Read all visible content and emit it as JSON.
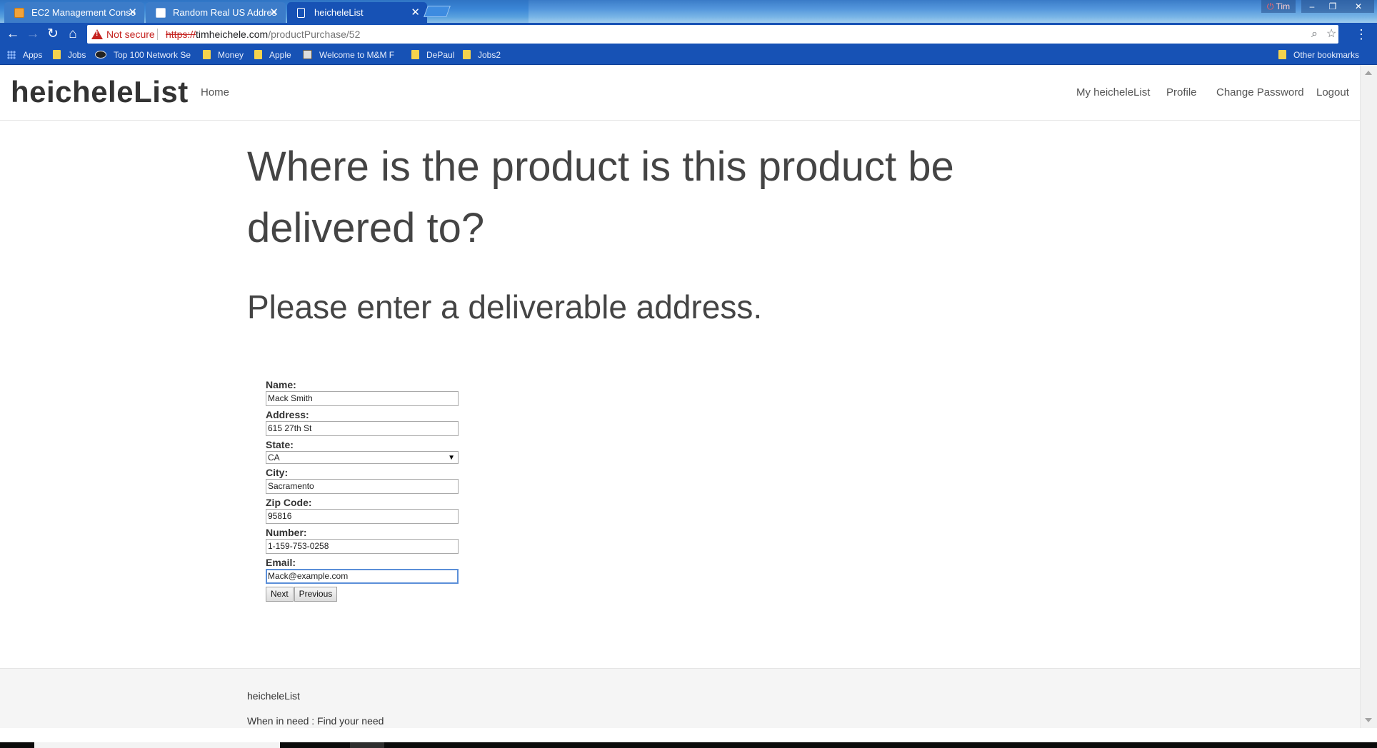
{
  "browser": {
    "tabs": [
      {
        "title": "EC2 Management Conso",
        "icon": "box-icon"
      },
      {
        "title": "Random Real US Addres",
        "icon": "document-icon"
      },
      {
        "title": "heicheleList",
        "icon": "page-icon"
      }
    ],
    "window_user": "Tim",
    "security_label": "Not secure",
    "url_scheme": "https://",
    "url_host": "timheichele.com",
    "url_path": "/productPurchase/52",
    "bookmarks": [
      "Apps",
      "Jobs",
      "Top 100 Network Se",
      "Money",
      "Apple",
      "Welcome to M&M F",
      "DePaul",
      "Jobs2"
    ],
    "other_bookmarks": "Other bookmarks"
  },
  "nav": {
    "brand": "heicheleList",
    "home": "Home",
    "my_list": "My heicheleList",
    "profile": "Profile",
    "change_password": "Change Password",
    "logout": "Logout"
  },
  "heading": "Where is the product is this product be delivered to?",
  "subheading": "Please enter a deliverable address.",
  "form": {
    "name_label": "Name:",
    "name_value": "Mack Smith",
    "address_label": "Address:",
    "address_value": "615 27th St",
    "state_label": "State:",
    "state_value": "CA",
    "city_label": "City:",
    "city_value": "Sacramento",
    "zip_label": "Zip Code:",
    "zip_value": "95816",
    "number_label": "Number:",
    "number_value": "1-159-753-0258",
    "email_label": "Email:",
    "email_value": "Mack@example.com",
    "next_label": "Next",
    "previous_label": "Previous"
  },
  "footer": {
    "brand": "heicheleList",
    "tagline": "When in need : Find your need"
  }
}
